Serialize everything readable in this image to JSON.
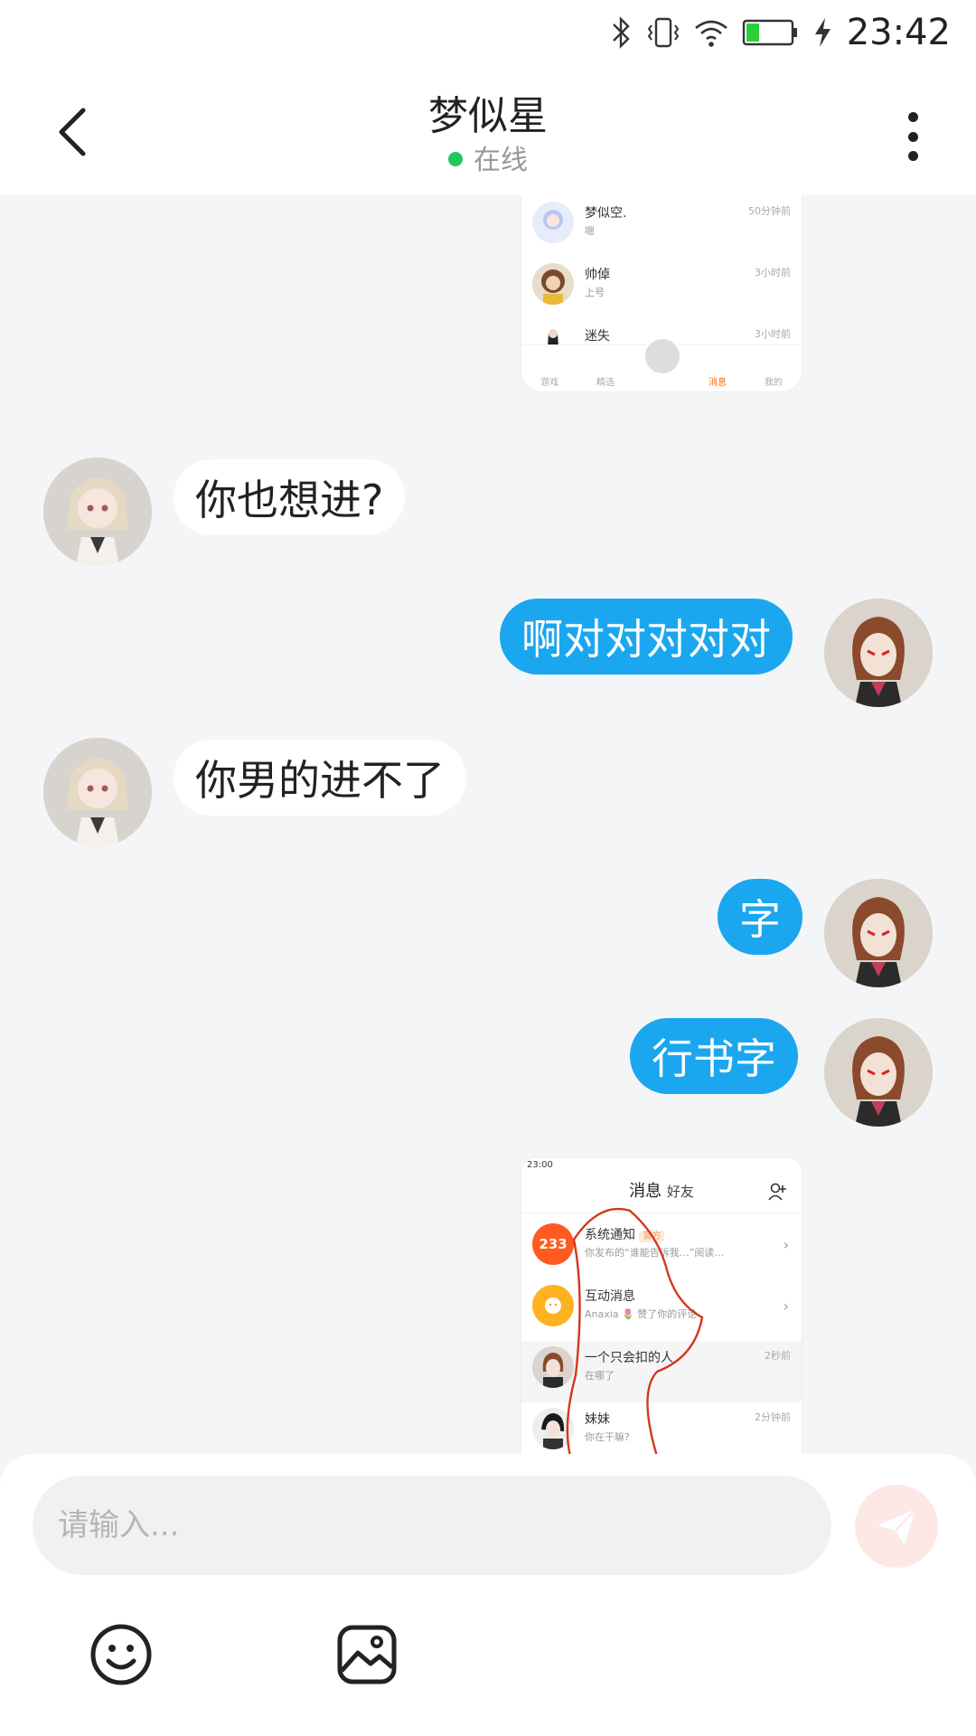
{
  "status_bar": {
    "time": "23:42",
    "icons": [
      "bluetooth-icon",
      "vibrate-icon",
      "wifi-icon",
      "battery-icon",
      "charging-icon"
    ],
    "battery_level": 0.25
  },
  "header": {
    "title": "梦似星",
    "presence": "在线",
    "back_icon": "back-arrow-icon",
    "more_icon": "more-vertical-icon"
  },
  "messages": [
    {
      "side": "out",
      "type": "image",
      "description_icon": "screenshot-friend-list"
    },
    {
      "side": "in",
      "type": "text",
      "text": "你也想进?"
    },
    {
      "side": "out",
      "type": "text",
      "text": "啊对对对对对"
    },
    {
      "side": "in",
      "type": "text",
      "text": "你男的进不了"
    },
    {
      "side": "out",
      "type": "text",
      "text": "字"
    },
    {
      "side": "out",
      "type": "text",
      "text": "行书字"
    },
    {
      "side": "out",
      "type": "image",
      "description_icon": "screenshot-message-list"
    }
  ],
  "shot_top": {
    "rows": [
      {
        "name": "梦似空.",
        "sub": "嗯",
        "time": "50分钟前"
      },
      {
        "name": "帅倬",
        "sub": "上号",
        "time": "3小时前"
      },
      {
        "name": "迷失",
        "sub": "",
        "time": "3小时前"
      }
    ],
    "tabs": [
      "游戏",
      "精选",
      "",
      "消息",
      "我的"
    ]
  },
  "shot_bottom": {
    "status_time": "23:00",
    "tabs": [
      "消息",
      "好友"
    ],
    "rows": [
      {
        "badge": "233",
        "name": "系统通知",
        "tag": "官方",
        "sub": "你发布的“谁能告诉我…”阅读…"
      },
      {
        "badge": "",
        "name": "互动消息",
        "tag": "",
        "sub": "Anaxia 🌷 赞了你的评论"
      },
      {
        "badge": "",
        "name": "一个只会扣的人",
        "tag": "",
        "sub": "在哪了",
        "time": "2秒前"
      },
      {
        "badge": "",
        "name": "妹妹",
        "tag": "",
        "sub": "你在干嘛?",
        "time": "2分钟前"
      }
    ]
  },
  "composer": {
    "placeholder": "请输入...",
    "send_icon": "send-icon",
    "emoji_icon": "emoji-icon",
    "image_icon": "image-icon"
  },
  "colors": {
    "outgoing_bubble": "#1aa7f0",
    "incoming_bubble": "#ffffff",
    "background": "#f4f5f7",
    "online_dot": "#22c55e",
    "send_button_disabled": "#fde8e6"
  }
}
